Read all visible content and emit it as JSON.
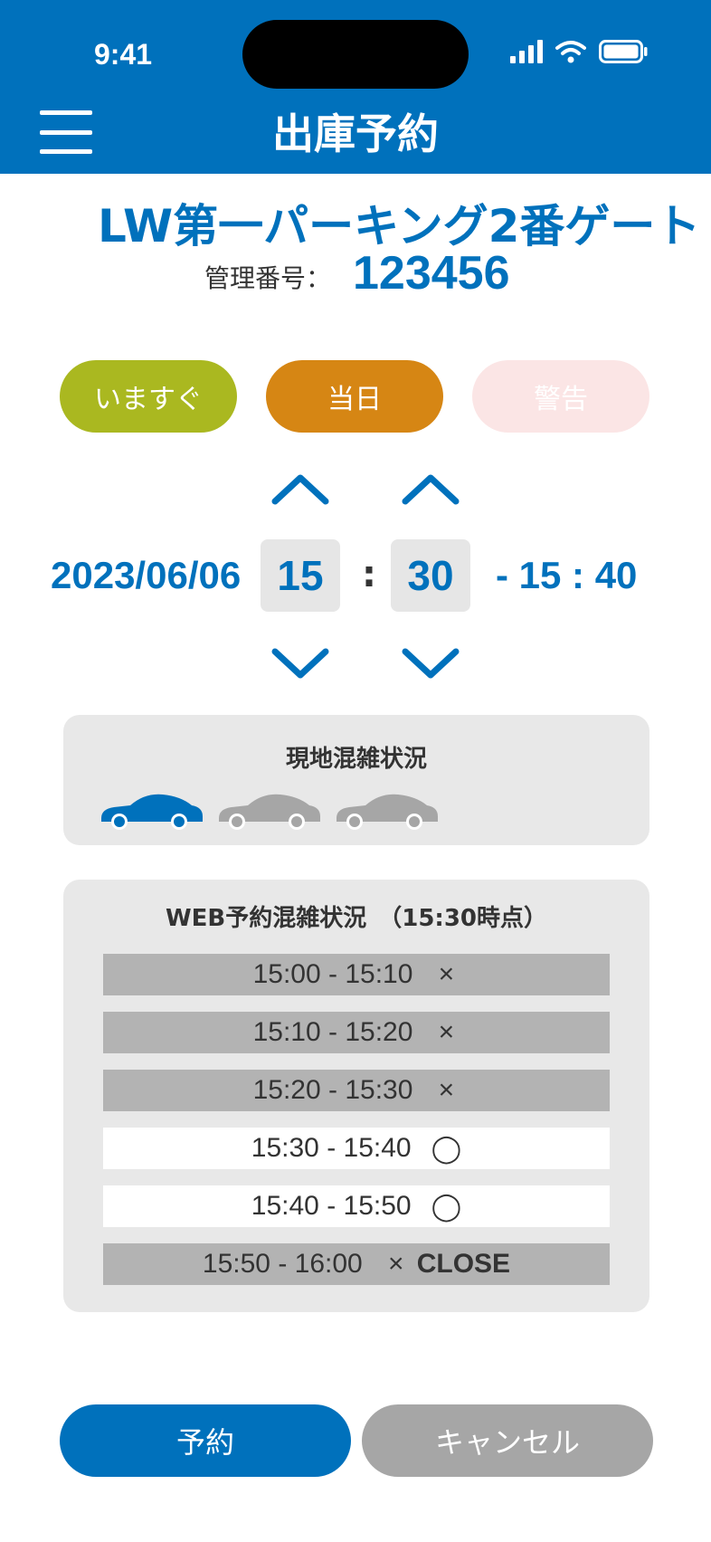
{
  "status_bar": {
    "time": "9:41"
  },
  "header": {
    "title": "出庫予約",
    "menu_icon": "hamburger-menu-icon"
  },
  "facility": {
    "name": "LW第一パーキング2番ゲート",
    "mgmt_label": "管理番号：",
    "mgmt_number": "123456"
  },
  "modes": {
    "now": "いますぐ",
    "today": "当日",
    "warning": "警告"
  },
  "colors": {
    "primary": "#0071bc",
    "now": "#aab820",
    "today": "#d68614",
    "warning": "#fbe5e5",
    "cancel": "#a6a6a6"
  },
  "datetime": {
    "date": "2023/06/06",
    "hour": "15",
    "colon": ":",
    "minute": "30",
    "end": "- 15 : 40"
  },
  "onsite": {
    "title": "現地混雑状況",
    "cars": [
      "occupied",
      "empty",
      "empty"
    ]
  },
  "web": {
    "title": "WEB予約混雑状況　（15:30時点）",
    "slots": [
      {
        "time": "15:00 - 15:10",
        "mark": "×",
        "note": "",
        "status": "full"
      },
      {
        "time": "15:10 - 15:20",
        "mark": "×",
        "note": "",
        "status": "full"
      },
      {
        "time": "15:20 - 15:30",
        "mark": "×",
        "note": "",
        "status": "full"
      },
      {
        "time": "15:30 - 15:40",
        "mark": "◯",
        "note": "",
        "status": "open"
      },
      {
        "time": "15:40 - 15:50",
        "mark": "◯",
        "note": "",
        "status": "open"
      },
      {
        "time": "15:50 - 16:00",
        "mark": "×",
        "note": "CLOSE",
        "status": "full"
      }
    ]
  },
  "actions": {
    "reserve": "予約",
    "cancel": "キャンセル"
  }
}
